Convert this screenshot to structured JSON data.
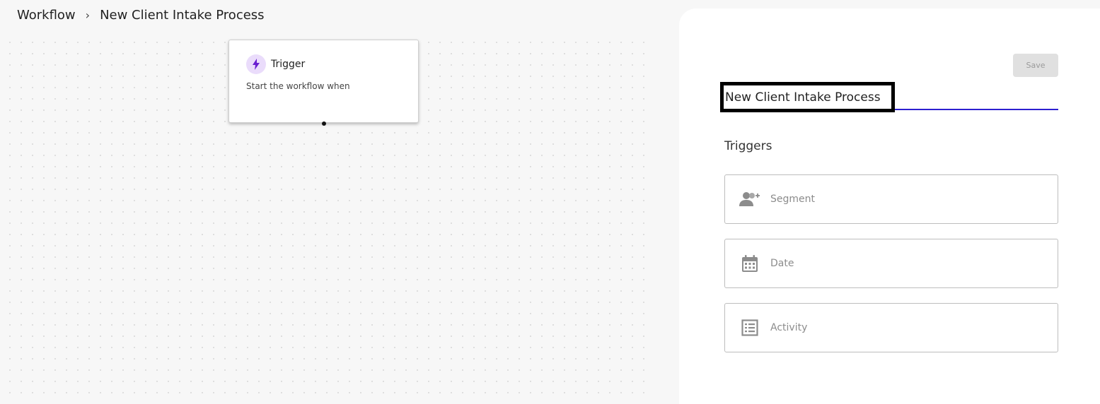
{
  "breadcrumb": {
    "root": "Workflow",
    "separator": "›",
    "current": "New Client Intake Process"
  },
  "node": {
    "title": "Trigger",
    "description": "Start the workflow when",
    "icon": "bolt-icon",
    "accent": "#6a1fd1"
  },
  "panel": {
    "save_label": "Save",
    "workflow_name": "New Client Intake Process",
    "section_title": "Triggers",
    "triggers": [
      {
        "label": "Segment",
        "icon": "user-add-icon"
      },
      {
        "label": "Date",
        "icon": "calendar-icon"
      },
      {
        "label": "Activity",
        "icon": "list-icon"
      }
    ]
  },
  "colors": {
    "input_underline": "#2d1fd0",
    "icon_gray": "#8c8c8c"
  }
}
